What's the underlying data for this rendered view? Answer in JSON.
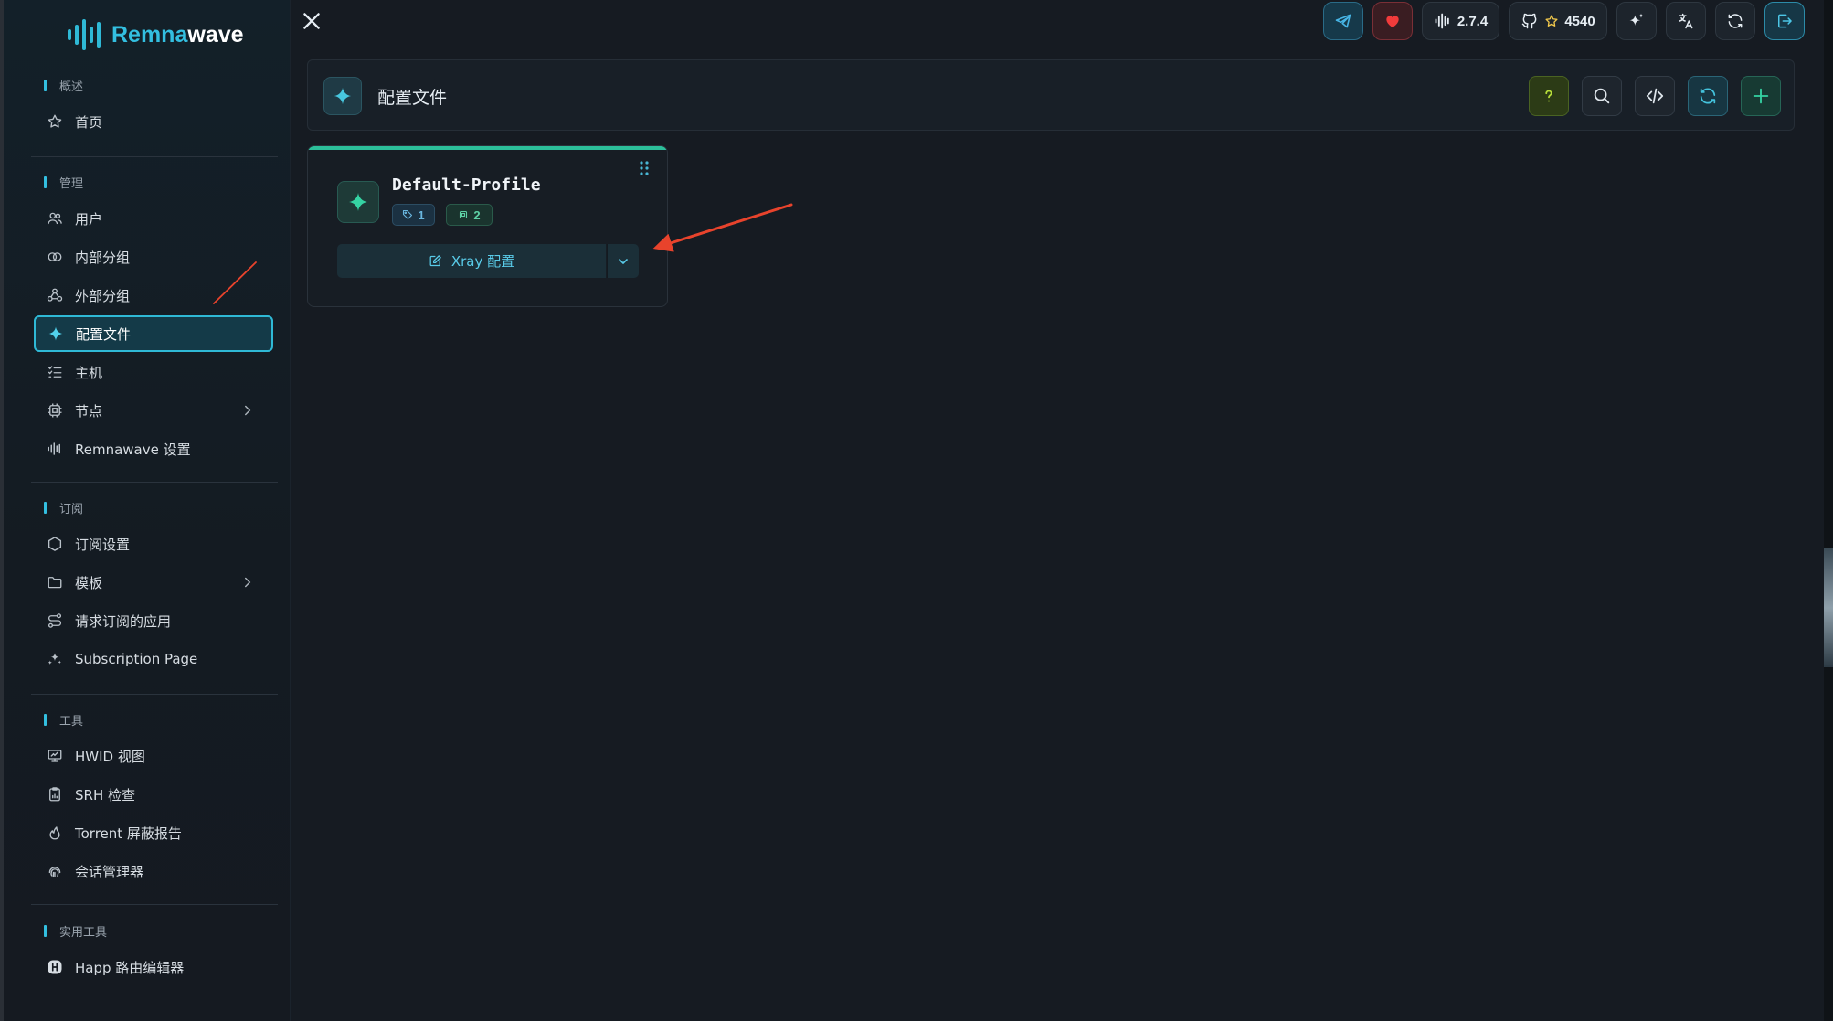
{
  "brand": {
    "name_part1": "Remna",
    "name_part2": "wave"
  },
  "sidebar": {
    "sections": [
      {
        "label": "概述",
        "items": [
          {
            "label": "首页",
            "icon": "star-icon"
          }
        ]
      },
      {
        "label": "管理",
        "items": [
          {
            "label": "用户",
            "icon": "users-icon"
          },
          {
            "label": "内部分组",
            "icon": "circles-icon"
          },
          {
            "label": "外部分组",
            "icon": "webhook-icon"
          },
          {
            "label": "配置文件",
            "icon": "sparkle-icon",
            "active": true
          },
          {
            "label": "主机",
            "icon": "list-check-icon"
          },
          {
            "label": "节点",
            "icon": "cpu-icon",
            "has_submenu": true
          },
          {
            "label": "Remnawave 设置",
            "icon": "wave-bars-icon"
          }
        ]
      },
      {
        "label": "订阅",
        "items": [
          {
            "label": "订阅设置",
            "icon": "hexagon-icon"
          },
          {
            "label": "模板",
            "icon": "folder-icon",
            "has_submenu": true
          },
          {
            "label": "请求订阅的应用",
            "icon": "route-icon"
          },
          {
            "label": "Subscription Page",
            "icon": "sparkles-icon"
          }
        ]
      },
      {
        "label": "工具",
        "items": [
          {
            "label": "HWID 视图",
            "icon": "monitor-icon"
          },
          {
            "label": "SRH 检查",
            "icon": "clipboard-chart-icon"
          },
          {
            "label": "Torrent 屏蔽报告",
            "icon": "flame-icon"
          },
          {
            "label": "会话管理器",
            "icon": "fingerprint-icon"
          }
        ]
      },
      {
        "label": "实用工具",
        "items": [
          {
            "label": "Happ 路由编辑器",
            "icon": "happ-logo-icon"
          }
        ]
      }
    ]
  },
  "topbar": {
    "version": "2.7.4",
    "github_stars": "4540"
  },
  "header": {
    "title": "配置文件"
  },
  "profile_card": {
    "name": "Default-Profile",
    "badge_tags": "1",
    "badge_nodes": "2",
    "action_label": "Xray 配置"
  },
  "colors": {
    "accent": "#2fb9d6",
    "card_accent": "#2cbf9a",
    "annotation_arrow": "#e8432c"
  }
}
